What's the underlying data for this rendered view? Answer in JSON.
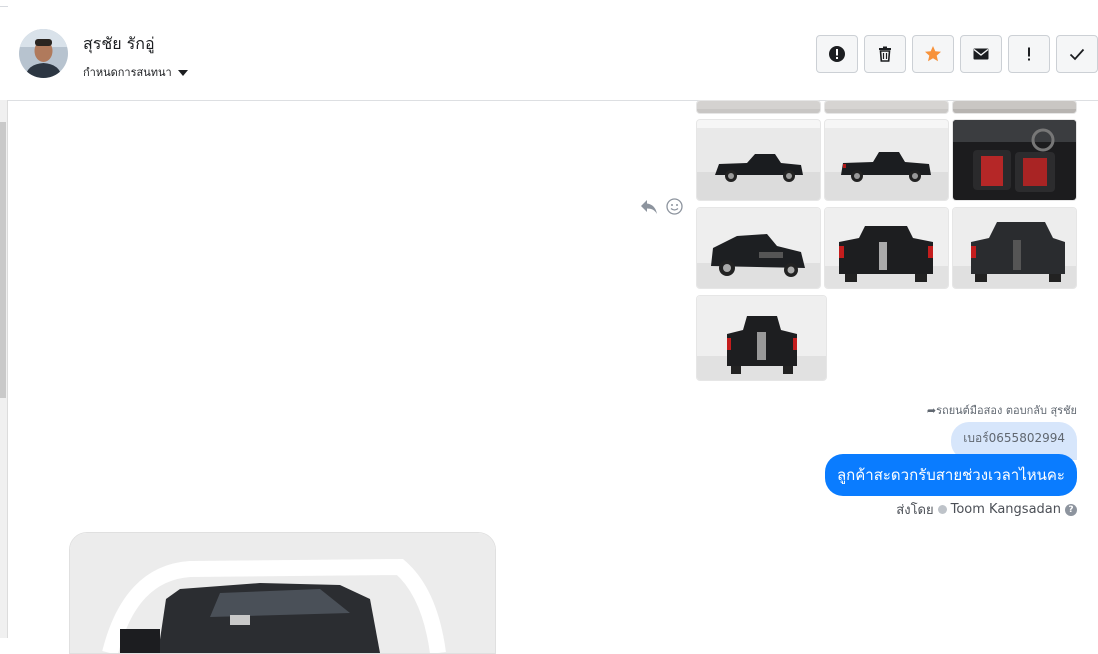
{
  "header": {
    "name": "สุรชัย รักอู่",
    "conversation_settings": "กำหนดการสนทนา",
    "actions": [
      {
        "name": "mark-spam-button",
        "icon": "exclamation-circle-icon"
      },
      {
        "name": "delete-button",
        "icon": "trash-icon"
      },
      {
        "name": "star-button",
        "icon": "star-icon",
        "color": "#f7923b"
      },
      {
        "name": "mark-unread-button",
        "icon": "envelope-icon"
      },
      {
        "name": "follow-up-button",
        "icon": "exclamation-icon"
      },
      {
        "name": "mark-done-button",
        "icon": "check-icon"
      }
    ]
  },
  "messages": {
    "reply_meta": "รถยนต์มือสอง ตอบกลับ สุรชัย",
    "quoted_text": "เบอร์0655802994",
    "bubble_text": "ลูกค้าสะดวกรับสายช่วงเวลาไหนคะ",
    "sent_by_label": "ส่งโดย",
    "sent_by_name": "Toom Kangsadan",
    "bubble_color": "#0a7cff"
  }
}
